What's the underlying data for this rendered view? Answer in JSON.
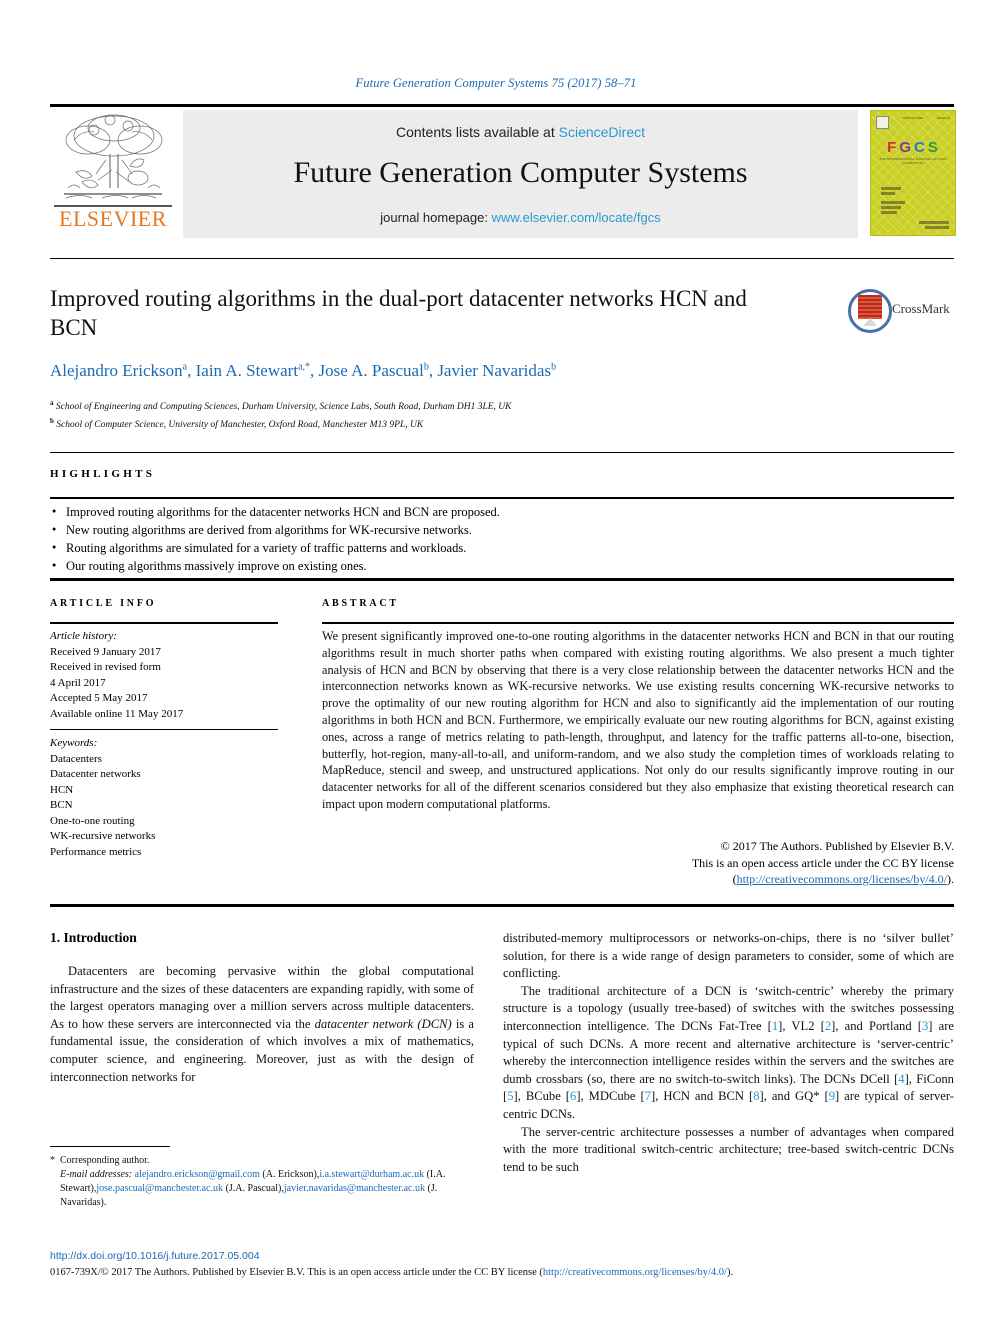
{
  "running_head": "Future Generation Computer Systems 75 (2017) 58–71",
  "masthead": {
    "contents_prefix": "Contents lists available at ",
    "sciencedirect": "ScienceDirect",
    "journal_title": "Future Generation Computer Systems",
    "homepage_prefix": "journal homepage: ",
    "homepage_url": "www.elsevier.com/locate/fgcs",
    "publisher_logo_text": "ELSEVIER",
    "cover": {
      "letters": [
        "F",
        "G",
        "C",
        "S"
      ],
      "subtitle": "THE INTERNATIONAL JOURNAL OF GRID COMPUTING",
      "top_left": "ISSN 0167-739X",
      "top_right": "Volume 75"
    }
  },
  "article": {
    "title": "Improved routing algorithms in the dual-port datacenter networks HCN and BCN",
    "crossmark_label": "CrossMark",
    "authors_html": "Alejandro Erickson<sup>a</sup>, Iain A. Stewart<sup>a,*</sup>, Jose A. Pascual<sup>b</sup>, Javier Navaridas<sup>b</sup>",
    "affiliation_a": "School of Engineering and Computing Sciences, Durham University, Science Labs, South Road, Durham DH1 3LE, UK",
    "affiliation_b": "School of Computer Science, University of Manchester, Oxford Road, Manchester M13 9PL, UK"
  },
  "highlights": {
    "heading": "HIGHLIGHTS",
    "items": [
      "Improved routing algorithms for the datacenter networks HCN and BCN are proposed.",
      "New routing algorithms are derived from algorithms for WK-recursive networks.",
      "Routing algorithms are simulated for a variety of traffic patterns and workloads.",
      "Our routing algorithms massively improve on existing ones."
    ]
  },
  "article_info": {
    "heading": "ARTICLE INFO",
    "history_label": "Article history:",
    "history": [
      "Received 9 January 2017",
      "Received in revised form",
      "4 April 2017",
      "Accepted 5 May 2017",
      "Available online 11 May 2017"
    ],
    "keywords_label": "Keywords:",
    "keywords": [
      "Datacenters",
      "Datacenter networks",
      "HCN",
      "BCN",
      "One-to-one routing",
      "WK-recursive networks",
      "Performance metrics"
    ]
  },
  "abstract": {
    "heading": "ABSTRACT",
    "text": "We present significantly improved one-to-one routing algorithms in the datacenter networks HCN and BCN in that our routing algorithms result in much shorter paths when compared with existing routing algorithms. We also present a much tighter analysis of HCN and BCN by observing that there is a very close relationship between the datacenter networks HCN and the interconnection networks known as WK-recursive networks. We use existing results concerning WK-recursive networks to prove the optimality of our new routing algorithm for HCN and also to significantly aid the implementation of our routing algorithms in both HCN and BCN. Furthermore, we empirically evaluate our new routing algorithms for BCN, against existing ones, across a range of metrics relating to path-length, throughput, and latency for the traffic patterns all-to-one, bisection, butterfly, hot-region, many-all-to-all, and uniform-random, and we also study the completion times of workloads relating to MapReduce, stencil and sweep, and unstructured applications. Not only do our results significantly improve routing in our datacenter networks for all of the different scenarios considered but they also emphasize that existing theoretical research can impact upon modern computational platforms.",
    "copyright_line1": "© 2017 The Authors. Published by Elsevier B.V.",
    "copyright_line2": "This is an open access article under the CC BY license",
    "license_open_paren": "(",
    "license_url": "http://creativecommons.org/licenses/by/4.0/",
    "license_close_paren": ")."
  },
  "body": {
    "section_heading": "1. Introduction",
    "left_paragraph": "Datacenters are becoming pervasive within the global computational infrastructure and the sizes of these datacenters are expanding rapidly, with some of the largest operators managing over a million servers across multiple datacenters. As to how these servers are interconnected via the ",
    "left_paragraph_italic": "datacenter network (DCN)",
    "left_paragraph_tail": " is a fundamental issue, the consideration of which involves a mix of mathematics, computer science, and engineering. Moreover, just as with the design of interconnection networks for",
    "right_p1": "distributed-memory multiprocessors or networks-on-chips, there is no ‘silver bullet’ solution, for there is a wide range of design parameters to consider, some of which are conflicting.",
    "right_p2_a": "The traditional architecture of a DCN is ‘switch-centric’ whereby the primary structure is a topology (usually tree-based) of switches with the switches possessing interconnection intelligence. The DCNs Fat-Tree [",
    "right_p2_r1": "1",
    "right_p2_b": "], VL2 [",
    "right_p2_r2": "2",
    "right_p2_c": "], and Portland [",
    "right_p2_r3": "3",
    "right_p2_d": "] are typical of such DCNs. A more recent and alternative architecture is ‘server-centric’ whereby the interconnection intelligence resides within the servers and the switches are dumb crossbars (so, there are no switch-to-switch links). The DCNs DCell [",
    "right_p2_r4": "4",
    "right_p2_e": "], FiConn [",
    "right_p2_r5": "5",
    "right_p2_f": "], BCube [",
    "right_p2_r6": "6",
    "right_p2_g": "], MDCube [",
    "right_p2_r7": "7",
    "right_p2_h": "], HCN and BCN [",
    "right_p2_r8": "8",
    "right_p2_i": "], and GQ* [",
    "right_p2_r9": "9",
    "right_p2_j": "] are typical of server-centric DCNs.",
    "right_p3": "The server-centric architecture possesses a number of advantages when compared with the more traditional switch-centric architecture; tree-based switch-centric DCNs tend to be such"
  },
  "footnote": {
    "asterisk": "*",
    "corresponding": "Corresponding author.",
    "email_label": "E-mail addresses:",
    "emails": [
      {
        "address": "alejandro.erickson@gmail.com",
        "owner": " (A. Erickson),"
      },
      {
        "address": "i.a.stewart@durham.ac.uk",
        "owner": " (I.A. Stewart),"
      },
      {
        "address": "jose.pascual@manchester.ac.uk",
        "owner": " (J.A. Pascual),"
      },
      {
        "address": "javier.navaridas@manchester.ac.uk",
        "owner": " (J. Navaridas)."
      }
    ]
  },
  "bottom": {
    "doi": "http://dx.doi.org/10.1016/j.future.2017.05.004",
    "license_prefix": "0167-739X/© 2017 The Authors. Published by Elsevier B.V. This is an open access article under the CC BY license (",
    "license_url": "http://creativecommons.org/licenses/by/4.0/",
    "license_suffix": ")."
  },
  "colors": {
    "link_blue": "#1a6bb5",
    "accent_cyan": "#2a9ad0",
    "elsevier_orange": "#E87722",
    "cover_yellow": "#c9cf23"
  }
}
